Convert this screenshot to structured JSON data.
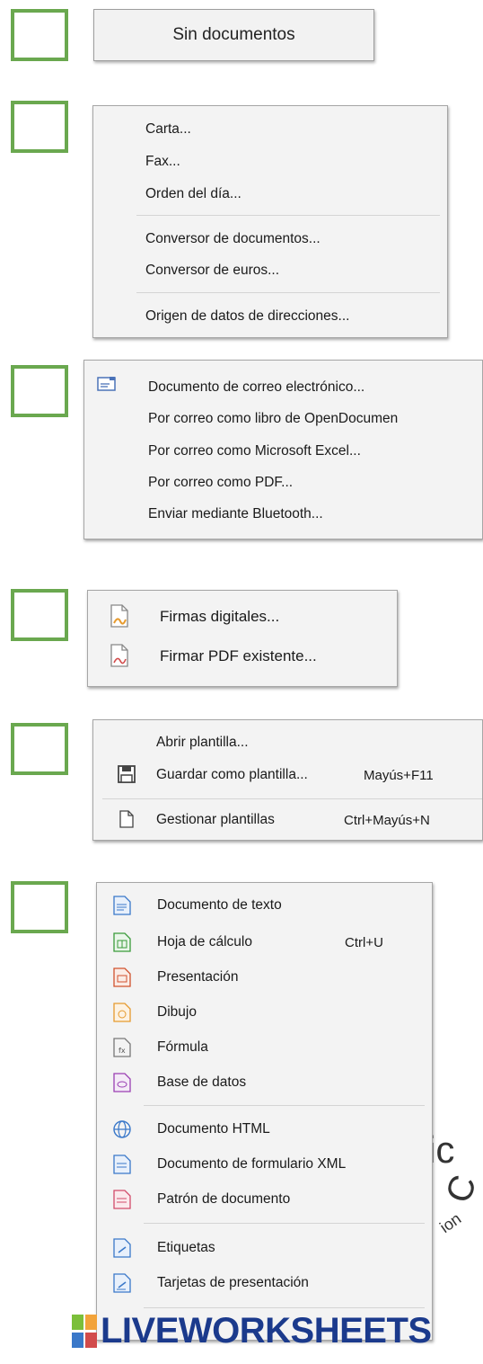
{
  "colors": {
    "box_border": "#6aa84f",
    "menu_bg": "#f3f3f3",
    "brand": "#1b3a8c"
  },
  "button1": {
    "label": "Sin documentos"
  },
  "menu2": {
    "items": [
      "Carta...",
      "Fax...",
      "Orden del día...",
      "Conversor de documentos...",
      "Conversor de euros...",
      "Origen de datos de direcciones..."
    ]
  },
  "menu3": {
    "items": [
      "Documento de correo electrónico...",
      "Por correo como libro de OpenDocumen",
      "Por correo como Microsoft Excel...",
      "Por correo como PDF...",
      "Enviar mediante Bluetooth..."
    ]
  },
  "menu4": {
    "items": [
      "Firmas digitales...",
      "Firmar PDF existente..."
    ]
  },
  "menu5": {
    "items": [
      "Abrir plantilla...",
      "Guardar como plantilla...",
      "Gestionar plantillas"
    ],
    "shortcuts": [
      "Mayús+F11",
      "Ctrl+Mayús+N"
    ]
  },
  "menu6": {
    "items": [
      "Documento de texto",
      "Hoja de cálculo",
      "Presentación",
      "Dibujo",
      "Fórmula",
      "Base de datos",
      "Documento HTML",
      "Documento de formulario XML",
      "Patrón de documento",
      "Etiquetas",
      "Tarjetas de presentación"
    ],
    "shortcuts": [
      "Ctrl+U"
    ]
  },
  "footer": {
    "brand": "LIVEWORKSHEETS"
  },
  "icons": [
    "email-icon",
    "signature-icon",
    "pdf-sign-icon",
    "save-icon",
    "page-icon",
    "writer-icon",
    "calc-icon",
    "impress-icon",
    "draw-icon",
    "math-icon",
    "base-icon",
    "globe-icon",
    "xml-form-icon",
    "template-icon",
    "labels-icon",
    "business-cards-icon",
    "liveworksheets-logo-icon"
  ]
}
